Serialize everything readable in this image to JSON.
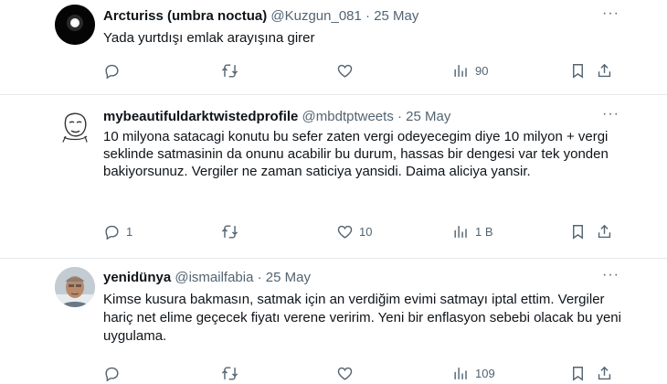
{
  "tweets": [
    {
      "name": "Arcturiss (umbra noctua)",
      "handle": "@Kuzgun_081",
      "date": "· 25 May",
      "text": "Yada yurtdışı emlak arayışına girer",
      "replies": "",
      "retweets": "",
      "likes": "",
      "views": "90",
      "more": "···"
    },
    {
      "name": "mybeautifuldarktwistedprofile",
      "handle": "@mbdtptweets",
      "date": "· 25 May",
      "text": "10 milyona satacagi konutu bu sefer zaten vergi odeyecegim diye 10 milyon + vergi seklinde satmasinin da onunu acabilir bu durum, hassas bir dengesi var tek yonden bakiyorsunuz. Vergiler ne zaman saticiya yansidi. Daima aliciya yansir.",
      "replies": "1",
      "retweets": "",
      "likes": "10",
      "views": "1 B",
      "more": "···"
    },
    {
      "name": "yenidünya",
      "handle": "@ismailfabia",
      "date": "· 25 May",
      "text": "Kimse kusura bakmasın,  satmak için an verdiğim evimi satmayı iptal ettim. Vergiler hariç net elime geçecek fiyatı verene veririm. Yeni bir enflasyon sebebi olacak bu yeni uygulama.",
      "replies": "",
      "retweets": "",
      "likes": "",
      "views": "109",
      "more": "···"
    }
  ]
}
